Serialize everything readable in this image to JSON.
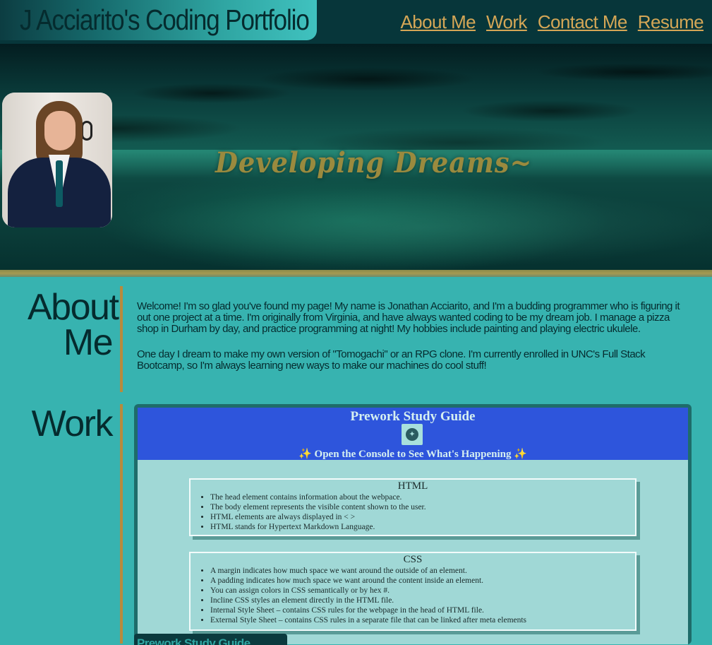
{
  "header": {
    "logo_text": "J Acciarito's Coding Portfolio",
    "nav": [
      "About Me",
      "Work",
      "Contact Me",
      "Resume"
    ]
  },
  "hero": {
    "tagline": "Developing Dreams~"
  },
  "about": {
    "title": "About Me",
    "paragraphs": [
      "Welcome! I'm so glad you've found my page! My name is Jonathan Acciarito, and I'm a budding programmer who is figuring it out one project at a time. I'm originally from Virginia, and have always wanted coding to be my dream job. I manage a pizza shop in Durham by day, and practice programming at night! My hobbies include painting and playing electric ukulele.",
      "One day I dream to make my own version of \"Tomogachi\" or an RPG clone. I'm currently enrolled in UNC's Full Stack Bootcamp, so I'm always learning new ways to make our machines do cool stuff!"
    ]
  },
  "work": {
    "title": "Work",
    "card": {
      "screenshot": {
        "title": "Prework Study Guide",
        "subtitle": "✨ Open the Console to See What's Happening ✨",
        "html_box": {
          "heading": "HTML",
          "items": [
            "The head element contains information about the webpace.",
            "The body element represents the visible content shown to the user.",
            "HTML elements are always displayed in < >",
            "HTML stands for Hypertext Markdown Language."
          ]
        },
        "css_box": {
          "heading": "CSS",
          "items": [
            "A margin indicates how much space we want around the outside of an element.",
            "A padding indicates how much space we want around the content inside an element.",
            "You can assign colors in CSS semantically or by hex #.",
            "Incline CSS styles an element directly in the HTML file.",
            "Internal Style Sheet – contains CSS rules for the webpage in the head of HTML file.",
            "External Style Sheet – contains CSS rules in a separate file that can be linked after meta elements"
          ]
        }
      },
      "caption": "Prework Study Guide"
    }
  },
  "colors": {
    "page_bg": "#37b3b0",
    "header_bg": "#07363a",
    "nav_link": "#d4a656",
    "accent_gold": "#b88a3c",
    "heading_text": "#052b2e",
    "study_guide_header": "#2e55dc"
  }
}
